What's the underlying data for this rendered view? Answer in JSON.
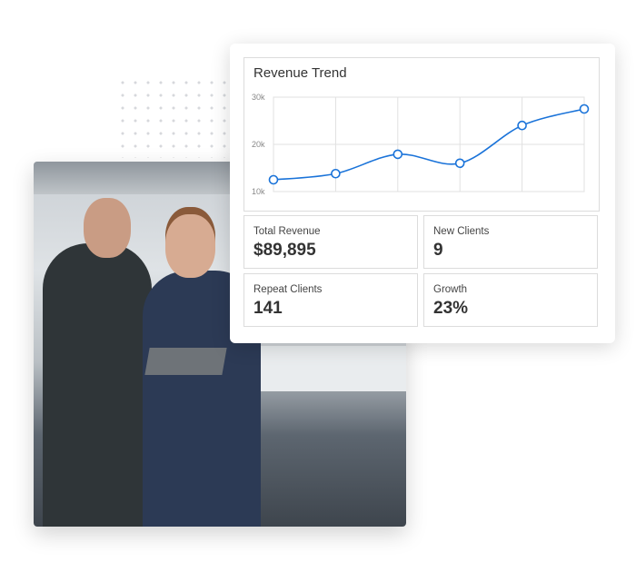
{
  "chart_data": {
    "type": "line",
    "title": "Revenue Trend",
    "y_ticks": [
      "30k",
      "20k",
      "10k"
    ],
    "ylim": [
      10000,
      30000
    ],
    "grid": true,
    "x": [
      1,
      2,
      3,
      4,
      5,
      6
    ],
    "values": [
      12500,
      13800,
      17900,
      16000,
      24000,
      27500
    ],
    "color": "#1a73d9"
  },
  "kpis": [
    {
      "label": "Total Revenue",
      "value": "$89,895"
    },
    {
      "label": "New Clients",
      "value": "9"
    },
    {
      "label": "Repeat Clients",
      "value": "141"
    },
    {
      "label": "Growth",
      "value": "23%"
    }
  ]
}
